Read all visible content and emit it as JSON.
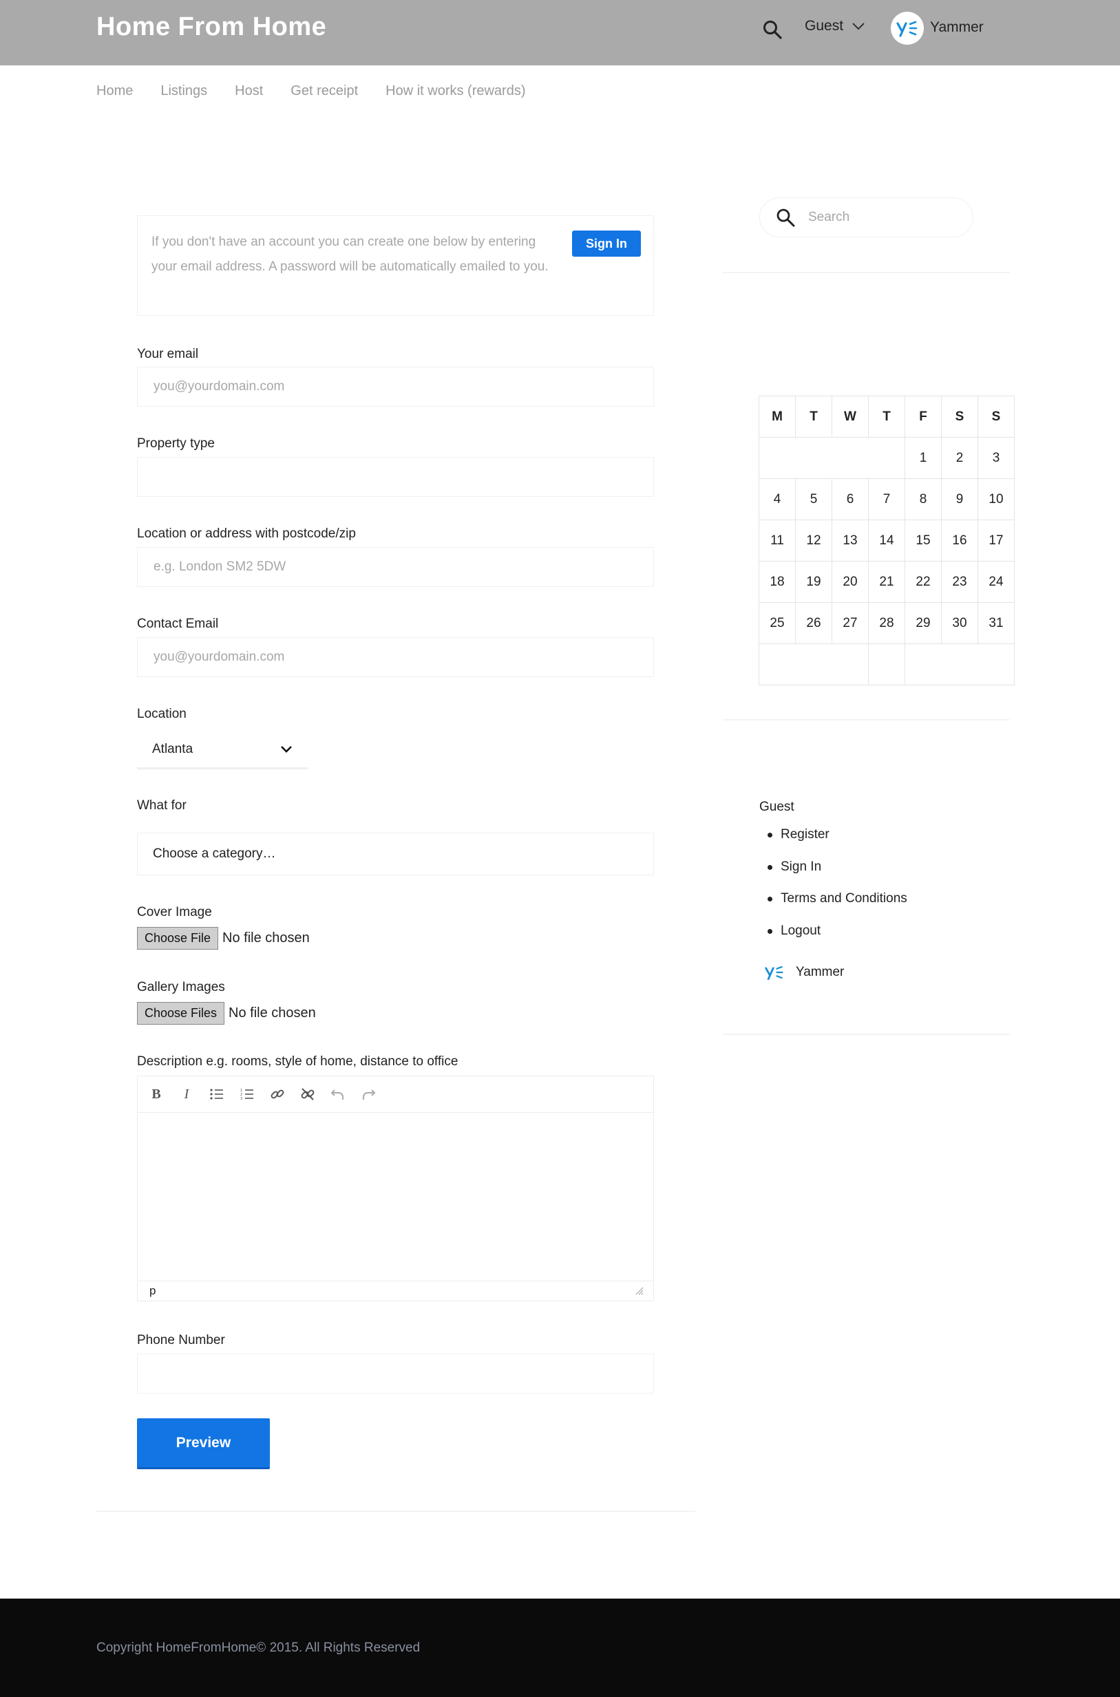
{
  "header": {
    "site_title": "Home From Home",
    "guest_label": "Guest",
    "yammer_label": "Yammer"
  },
  "nav": [
    "Home",
    "Listings",
    "Host",
    "Get receipt",
    "How it works (rewards)"
  ],
  "notice": {
    "text": "If you don't have an account you can create one below by entering your email address. A password will be automatically emailed to you.",
    "signin_label": "Sign In"
  },
  "form": {
    "email_label": "Your email",
    "email_placeholder": "you@yourdomain.com",
    "property_type_label": "Property type",
    "location_address_label": "Location or address with postcode/zip",
    "location_address_placeholder": "e.g. London SM2 5DW",
    "contact_email_label": "Contact Email",
    "contact_email_placeholder": "you@yourdomain.com",
    "location_label": "Location",
    "location_value": "Atlanta",
    "what_for_label": "What for",
    "category_value": "Choose a category…",
    "cover_image_label": "Cover Image",
    "cover_button": "Choose File",
    "cover_status": "No file chosen",
    "gallery_label": "Gallery Images",
    "gallery_button": "Choose Files",
    "gallery_status": "No file chosen",
    "description_label": "Description e.g. rooms, style of home, distance to office",
    "editor_path": "p",
    "phone_label": "Phone Number",
    "preview_label": "Preview"
  },
  "sidebar": {
    "search_placeholder": "Search",
    "calendar": {
      "weekdays": [
        "M",
        "T",
        "W",
        "T",
        "F",
        "S",
        "S"
      ],
      "weeks": [
        [
          "",
          "",
          "",
          "",
          "1",
          "2",
          "3"
        ],
        [
          "4",
          "5",
          "6",
          "7",
          "8",
          "9",
          "10"
        ],
        [
          "11",
          "12",
          "13",
          "14",
          "15",
          "16",
          "17"
        ],
        [
          "18",
          "19",
          "20",
          "21",
          "22",
          "23",
          "24"
        ],
        [
          "25",
          "26",
          "27",
          "28",
          "29",
          "30",
          "31"
        ]
      ]
    },
    "guest_heading": "Guest",
    "links": [
      "Register",
      "Sign In",
      "Terms and Conditions",
      "Logout"
    ],
    "yammer_label": "Yammer"
  },
  "footer": {
    "copyright": "Copyright HomeFromHome© 2015. All Rights Reserved"
  },
  "colors": {
    "header_bg": "#aaaaaa",
    "accent_blue": "#1275e3",
    "footer_bg": "#0b0b0b",
    "yammer_blue": "#1a8fd8"
  }
}
